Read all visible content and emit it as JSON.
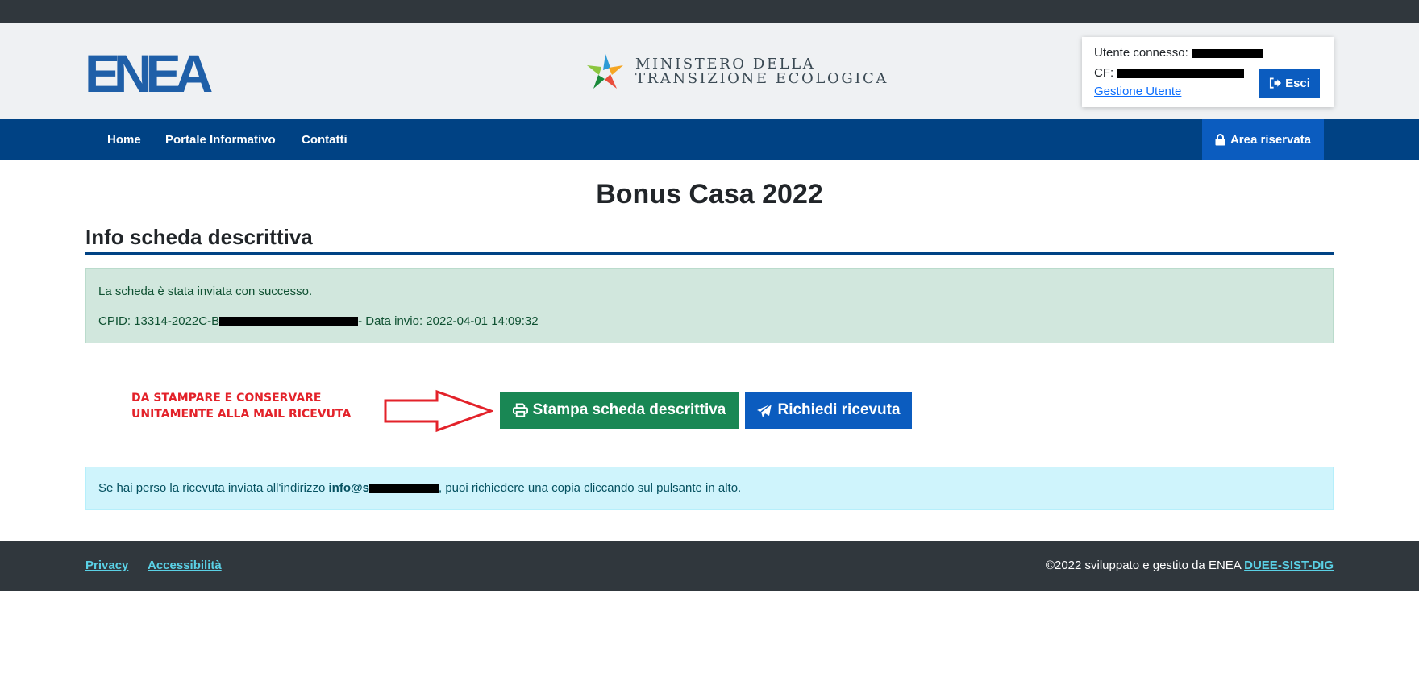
{
  "header": {
    "logo_text": "ENEA",
    "ministry_line1": "MINISTERO DELLA",
    "ministry_line2": "TRANSIZIONE ECOLOGICA",
    "user_label": "Utente connesso:",
    "cf_label": "CF:",
    "manage_user_link": "Gestione Utente",
    "logout_label": "Esci"
  },
  "nav": {
    "items": [
      "Home",
      "Portale Informativo",
      "Contatti"
    ],
    "reserved_area": "Area riservata"
  },
  "main": {
    "title": "Bonus Casa 2022",
    "section_title": "Info scheda descrittiva",
    "success_message": "La scheda è stata inviata con successo.",
    "cpid_prefix": "CPID: 13314-2022C-B",
    "cpid_suffix": "- Data invio: 2022-04-01 14:09:32",
    "note_line1": "DA STAMPARE E CONSERVARE",
    "note_line2": "UNITAMENTE ALLA MAIL RICEVUTA",
    "print_button": "Stampa scheda descrittiva",
    "receipt_button": "Richiedi ricevuta",
    "info_prefix": "Se hai perso la ricevuta inviata all'indirizzo ",
    "info_email": "info@s",
    "info_suffix": ", puoi richiedere una copia cliccando sul pulsante in alto."
  },
  "footer": {
    "privacy": "Privacy",
    "accessibility": "Accessibilità",
    "credits": "©2022 sviluppato e gestito da ENEA ",
    "credits_link": "DUEE-SIST-DIG"
  },
  "colors": {
    "nav_blue": "#004284",
    "button_blue": "#0b5cbf",
    "button_green": "#198754",
    "note_red": "#e3222a"
  }
}
